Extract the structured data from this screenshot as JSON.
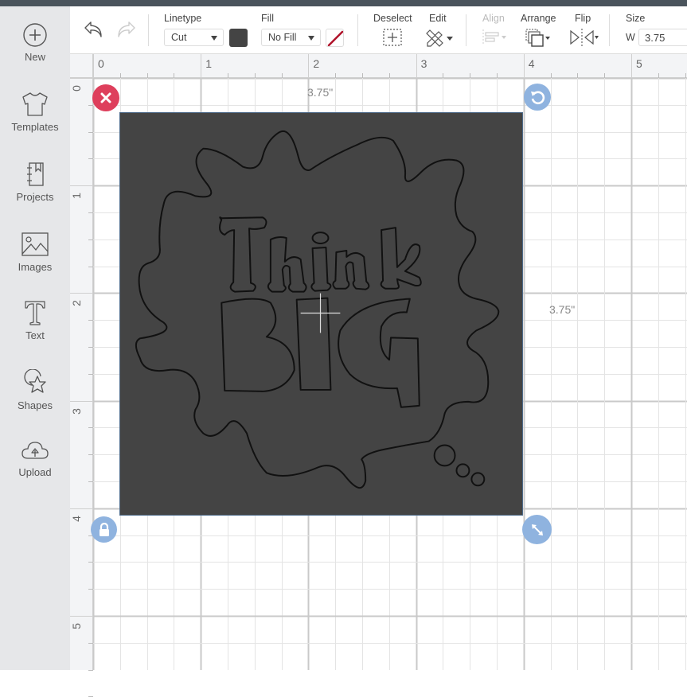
{
  "sidebar": {
    "items": [
      {
        "label": "New",
        "icon": "plus-circle-icon"
      },
      {
        "label": "Templates",
        "icon": "tshirt-icon"
      },
      {
        "label": "Projects",
        "icon": "notebook-icon"
      },
      {
        "label": "Images",
        "icon": "image-icon"
      },
      {
        "label": "Text",
        "icon": "text-icon"
      },
      {
        "label": "Shapes",
        "icon": "shapes-icon"
      },
      {
        "label": "Upload",
        "icon": "cloud-upload-icon"
      }
    ]
  },
  "toolbar": {
    "undo_icon": "undo-icon",
    "redo_icon": "redo-icon",
    "linetype": {
      "label": "Linetype",
      "value": "Cut",
      "color": "#444444"
    },
    "fill": {
      "label": "Fill",
      "value": "No Fill",
      "no_fill_color": "#b0122a"
    },
    "deselect": {
      "label": "Deselect"
    },
    "edit": {
      "label": "Edit"
    },
    "align": {
      "label": "Align",
      "disabled": true
    },
    "arrange": {
      "label": "Arrange"
    },
    "flip": {
      "label": "Flip"
    },
    "size": {
      "label": "Size",
      "w_label": "W",
      "w_value": "3.75"
    }
  },
  "rulers": {
    "horizontal": [
      "0",
      "1",
      "2",
      "3",
      "4",
      "5"
    ],
    "vertical": [
      "0",
      "1",
      "2",
      "3",
      "4",
      "5"
    ]
  },
  "canvas": {
    "width_label": "3.75\"",
    "height_label": "3.75\"",
    "design": {
      "name": "Think BIG thought bubble",
      "text_line_1": "Think",
      "text_line_2": "BIG",
      "background_color": "#444444",
      "outline_color": "#111111"
    },
    "handles": {
      "delete": {
        "icon": "close-icon",
        "color": "#de3f5c"
      },
      "rotate": {
        "icon": "rotate-icon",
        "color": "#8fb3df"
      },
      "lock": {
        "icon": "lock-icon",
        "color": "#8fb3df"
      },
      "resize": {
        "icon": "resize-icon",
        "color": "#8fb3df"
      }
    }
  }
}
